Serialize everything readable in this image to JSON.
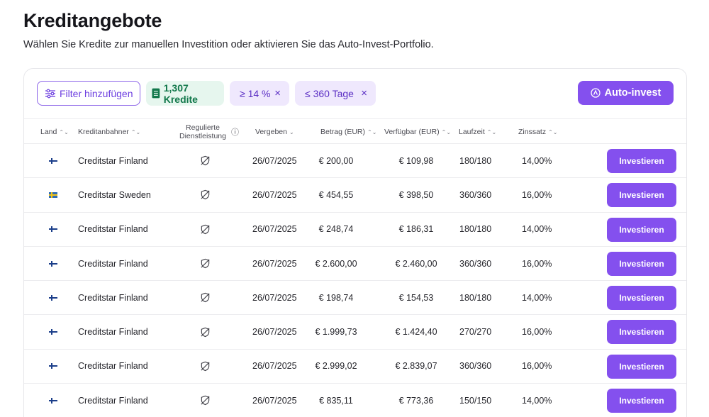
{
  "page": {
    "title": "Kreditangebote",
    "subtitle": "Wählen Sie Kredite zur manuellen Investition oder aktivieren Sie das Auto-Invest-Portfolio."
  },
  "toolbar": {
    "filter_label": "Filter hinzufügen",
    "count_label": "1,307 Kredite",
    "rate_chip": "≥ 14 %",
    "days_chip": "≤ 360 Tage",
    "close_glyph": "×",
    "auto_invest_label": "Auto-invest"
  },
  "colors": {
    "accent": "#8450ee",
    "count_chip_bg": "#e6f6ee",
    "count_chip_text": "#12784b",
    "filter_chip_bg": "#efe8fd"
  },
  "table": {
    "headers": {
      "land": "Land",
      "anbahner": "Kreditanbahner",
      "reguliert_1": "Regulierte",
      "reguliert_2": "Dienstleistung",
      "vergeben": "Vergeben",
      "betrag": "Betrag (EUR)",
      "verfuegbar": "Verfügbar (EUR)",
      "laufzeit": "Laufzeit",
      "zinssatz": "Zinssatz"
    },
    "sort_glyph": "⌃⌄",
    "sort_down_glyph": "⌄",
    "info_glyph": "ⓘ",
    "invest_label": "Investieren",
    "rows": [
      {
        "flag": "fi",
        "anbahner": "Creditstar Finland",
        "vergeben": "26/07/2025",
        "betrag": "€ 200,00",
        "verfuegbar": "€ 109,98",
        "laufzeit": "180/180",
        "zinssatz": "14,00%"
      },
      {
        "flag": "se",
        "anbahner": "Creditstar Sweden",
        "vergeben": "26/07/2025",
        "betrag": "€ 454,55",
        "verfuegbar": "€ 398,50",
        "laufzeit": "360/360",
        "zinssatz": "16,00%"
      },
      {
        "flag": "fi",
        "anbahner": "Creditstar Finland",
        "vergeben": "26/07/2025",
        "betrag": "€ 248,74",
        "verfuegbar": "€ 186,31",
        "laufzeit": "180/180",
        "zinssatz": "14,00%"
      },
      {
        "flag": "fi",
        "anbahner": "Creditstar Finland",
        "vergeben": "26/07/2025",
        "betrag": "€ 2.600,00",
        "verfuegbar": "€ 2.460,00",
        "laufzeit": "360/360",
        "zinssatz": "16,00%"
      },
      {
        "flag": "fi",
        "anbahner": "Creditstar Finland",
        "vergeben": "26/07/2025",
        "betrag": "€ 198,74",
        "verfuegbar": "€ 154,53",
        "laufzeit": "180/180",
        "zinssatz": "14,00%"
      },
      {
        "flag": "fi",
        "anbahner": "Creditstar Finland",
        "vergeben": "26/07/2025",
        "betrag": "€ 1.999,73",
        "verfuegbar": "€ 1.424,40",
        "laufzeit": "270/270",
        "zinssatz": "16,00%"
      },
      {
        "flag": "fi",
        "anbahner": "Creditstar Finland",
        "vergeben": "26/07/2025",
        "betrag": "€ 2.999,02",
        "verfuegbar": "€ 2.839,07",
        "laufzeit": "360/360",
        "zinssatz": "16,00%"
      },
      {
        "flag": "fi",
        "anbahner": "Creditstar Finland",
        "vergeben": "26/07/2025",
        "betrag": "€ 835,11",
        "verfuegbar": "€ 773,36",
        "laufzeit": "150/150",
        "zinssatz": "14,00%"
      }
    ]
  }
}
